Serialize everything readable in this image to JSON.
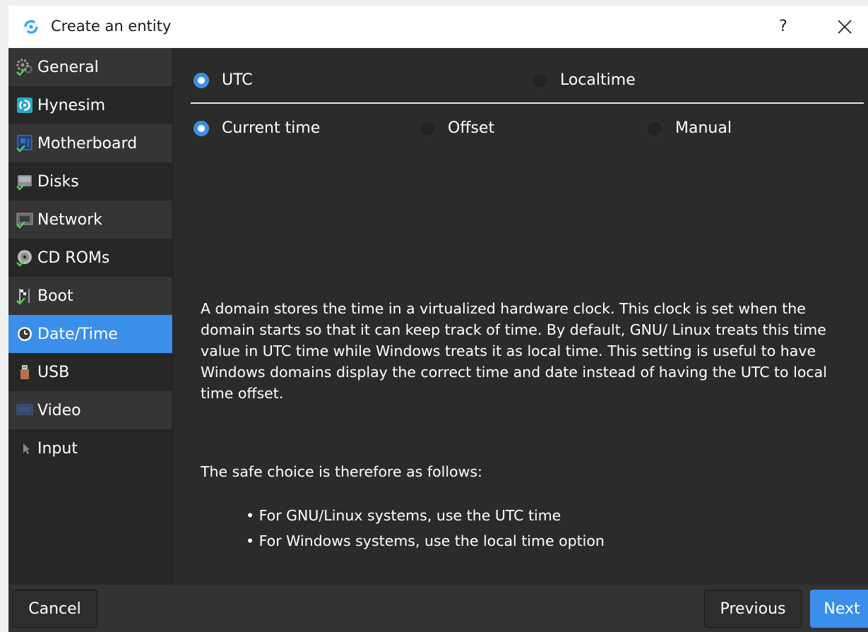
{
  "window": {
    "title": "Create an entity",
    "help_label": "?",
    "app_icon": "entity-logo-icon",
    "accent_color": "#3b8eea"
  },
  "sidebar": {
    "items": [
      {
        "label": "General",
        "icon": "gear-icon",
        "active": false
      },
      {
        "label": "Hynesim",
        "icon": "hynesim-logo-icon",
        "active": false
      },
      {
        "label": "Motherboard",
        "icon": "motherboard-icon",
        "active": false
      },
      {
        "label": "Disks",
        "icon": "disk-icon",
        "active": false
      },
      {
        "label": "Network",
        "icon": "network-icon",
        "active": false
      },
      {
        "label": "CD ROMs",
        "icon": "cdrom-icon",
        "active": false
      },
      {
        "label": "Boot",
        "icon": "boot-flag-icon",
        "active": false
      },
      {
        "label": "Date/Time",
        "icon": "clock-icon",
        "active": true
      },
      {
        "label": "USB",
        "icon": "usb-icon",
        "active": false
      },
      {
        "label": "Video",
        "icon": "video-icon",
        "active": false
      },
      {
        "label": "Input",
        "icon": "cursor-icon",
        "active": false
      }
    ]
  },
  "main": {
    "clock_mode": {
      "options": [
        "UTC",
        "Localtime"
      ],
      "selected": "UTC"
    },
    "time_source": {
      "options": [
        "Current time",
        "Offset",
        "Manual"
      ],
      "selected": "Current time"
    },
    "description": "A domain stores the time in a virtualized hardware clock. This clock is set when the domain starts so that it can keep track of time. By default, GNU/ Linux treats this time value in UTC time while Windows treats it as local time. This setting is useful to have Windows domains display the correct time and date instead of having the UTC to local time offset.",
    "safe_choice_heading": "The safe choice is therefore as follows:",
    "bullets": [
      "• For GNU/Linux systems, use the UTC time",
      "• For Windows systems, use the local time option"
    ]
  },
  "footer": {
    "cancel_label": "Cancel",
    "previous_label": "Previous",
    "next_label": "Next"
  }
}
